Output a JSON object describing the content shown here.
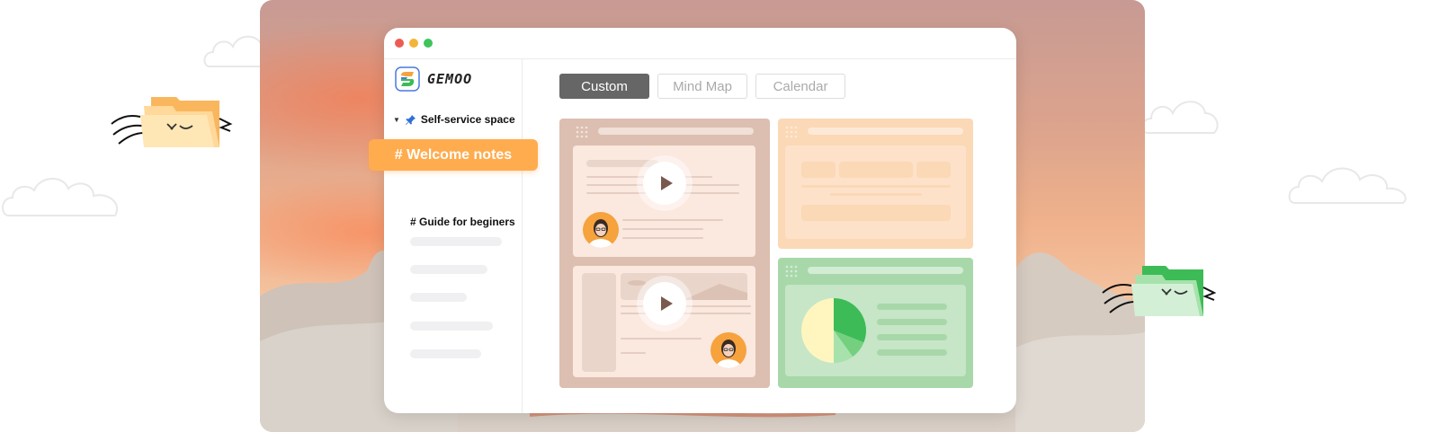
{
  "window": {
    "traffic_lights": [
      "#ee5b52",
      "#f3b43a",
      "#3ec45b"
    ]
  },
  "sidebar": {
    "logo_text": "GEMOO",
    "space": {
      "caret": "▼",
      "icon": "pushpin-icon",
      "label": "Self-service space"
    },
    "items": [
      {
        "label": "# Welcome notes",
        "active": true
      },
      {
        "label": "# Guide for beginers",
        "active": false
      }
    ]
  },
  "tabs": [
    {
      "label": "Custom",
      "active": true
    },
    {
      "label": "Mind Map",
      "active": false
    },
    {
      "label": "Calendar",
      "active": false
    }
  ],
  "colors": {
    "accent": "#ffac4f",
    "tab_active": "#666666",
    "board_brown": "#dcbfb0",
    "board_peach": "#fbd8b6",
    "board_green": "#a8d8a9",
    "pie_yellow": "#fff6bf",
    "pie_green": "#3dbb57",
    "pie_mid_green": "#74d07f",
    "pie_light_green": "#a7e2ac"
  },
  "pie_slices": [
    {
      "share": 0.31,
      "color": "#3dbb57"
    },
    {
      "share": 0.09,
      "color": "#74d07f"
    },
    {
      "share": 0.1,
      "color": "#a7e2ac"
    },
    {
      "share": 0.5,
      "color": "#fff6bf"
    }
  ]
}
